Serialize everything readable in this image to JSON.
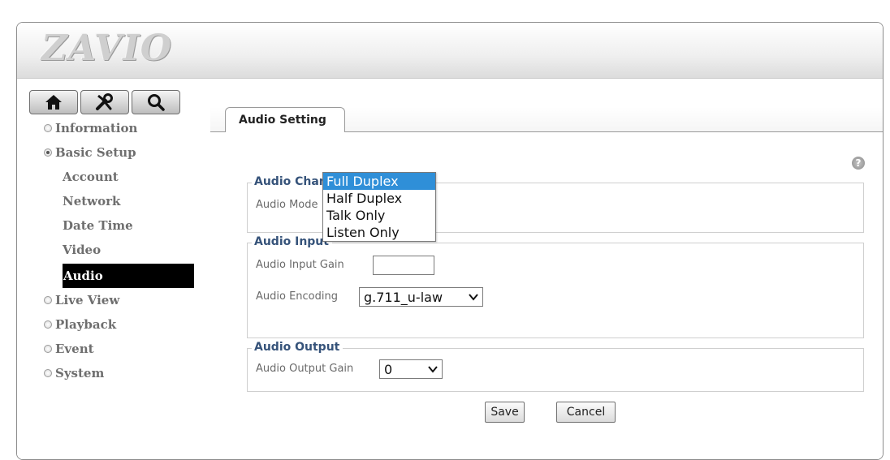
{
  "brand": {
    "logo_text": "ZAVIO"
  },
  "toolbar": {
    "buttons": [
      {
        "icon": "home-icon"
      },
      {
        "icon": "tools-icon"
      },
      {
        "icon": "search-icon"
      }
    ]
  },
  "nav": {
    "information": "Information",
    "basic_setup": "Basic Setup",
    "sub": {
      "account": "Account",
      "network": "Network",
      "date_time": "Date Time",
      "video": "Video",
      "audio": "Audio"
    },
    "live_view": "Live View",
    "playback": "Playback",
    "event": "Event",
    "system": "System"
  },
  "tab": {
    "label": "Audio Setting"
  },
  "help": {
    "glyph": "?"
  },
  "audio_channel": {
    "legend": "Audio Channel",
    "mode_label": "Audio Mode",
    "mode_options": [
      "Full Duplex",
      "Half Duplex",
      "Talk Only",
      "Listen Only"
    ],
    "mode_selected": "Full Duplex"
  },
  "audio_input": {
    "legend": "Audio Input",
    "gain_label": "Audio Input Gain",
    "encoding_label": "Audio Encoding",
    "encoding_value": "g.711_u-law"
  },
  "audio_output": {
    "legend": "Audio Output",
    "gain_label": "Audio Output Gain",
    "gain_value": "0"
  },
  "actions": {
    "save": "Save",
    "cancel": "Cancel"
  },
  "colors": {
    "legend": "#36537a",
    "selected_option": "#2f8fd8",
    "active_nav": "#000000"
  }
}
